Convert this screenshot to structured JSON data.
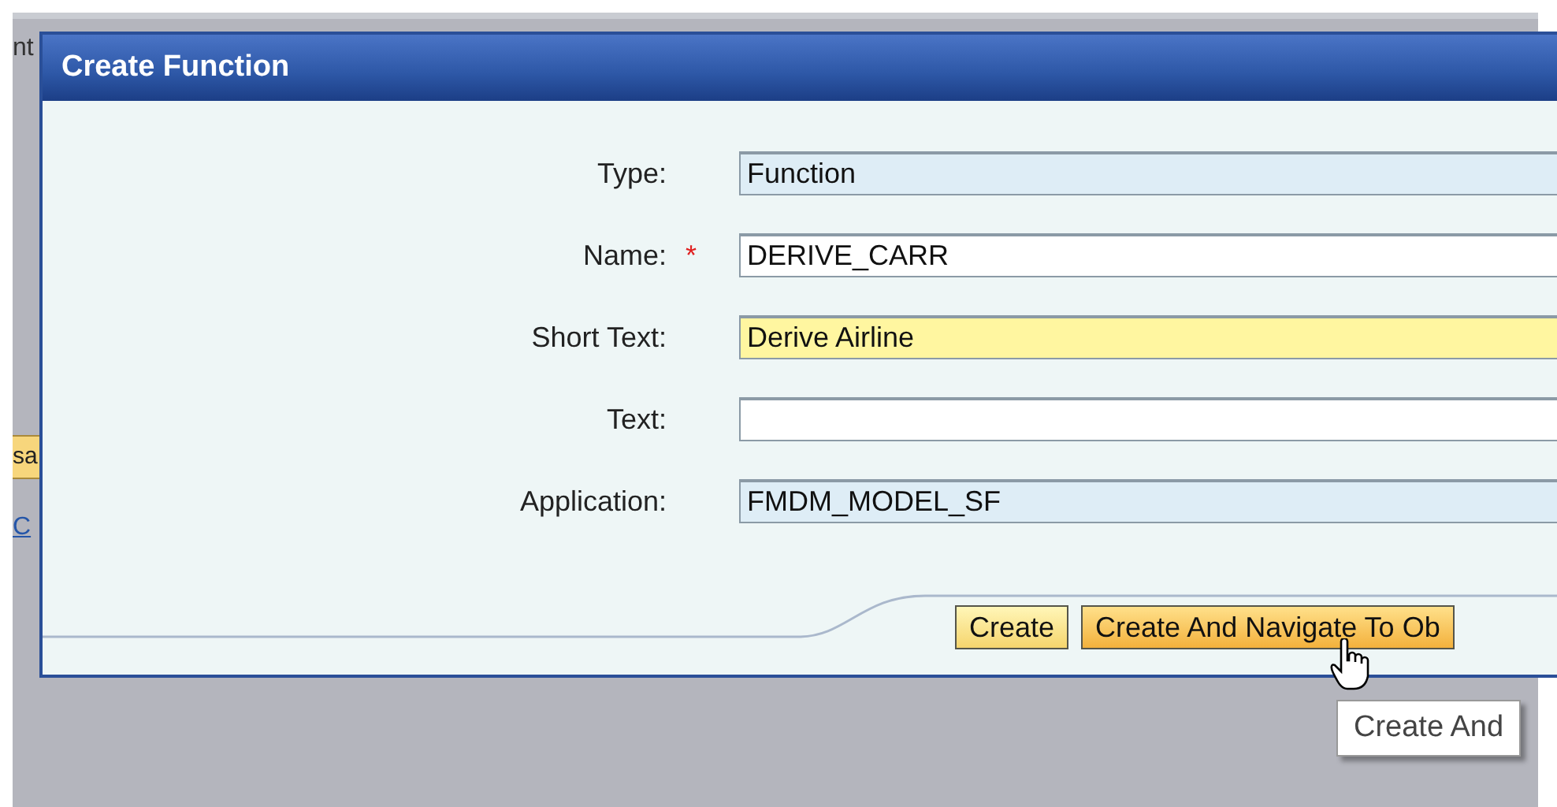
{
  "background": {
    "heading_fragment": "nt",
    "button_fragment": "sa",
    "link_fragment": "C"
  },
  "dialog": {
    "title": "Create Function",
    "fields": [
      {
        "label": "Type:",
        "value": "Function",
        "kind": "readonly"
      },
      {
        "label": "Name:",
        "required_mark": "*",
        "value": "DERIVE_CARR",
        "kind": "input"
      },
      {
        "label": "Short Text:",
        "value": "Derive Airline",
        "kind": "focused"
      },
      {
        "label": "Text:",
        "kind": "input"
      },
      {
        "label": "Application:",
        "value": "FMDM_MODEL_SF",
        "kind": "readonly"
      }
    ],
    "buttons": [
      {
        "label": "Create",
        "hovered": false
      },
      {
        "label": "Create And Navigate To Ob",
        "hovered": true
      }
    ]
  },
  "tooltip": "Create And"
}
